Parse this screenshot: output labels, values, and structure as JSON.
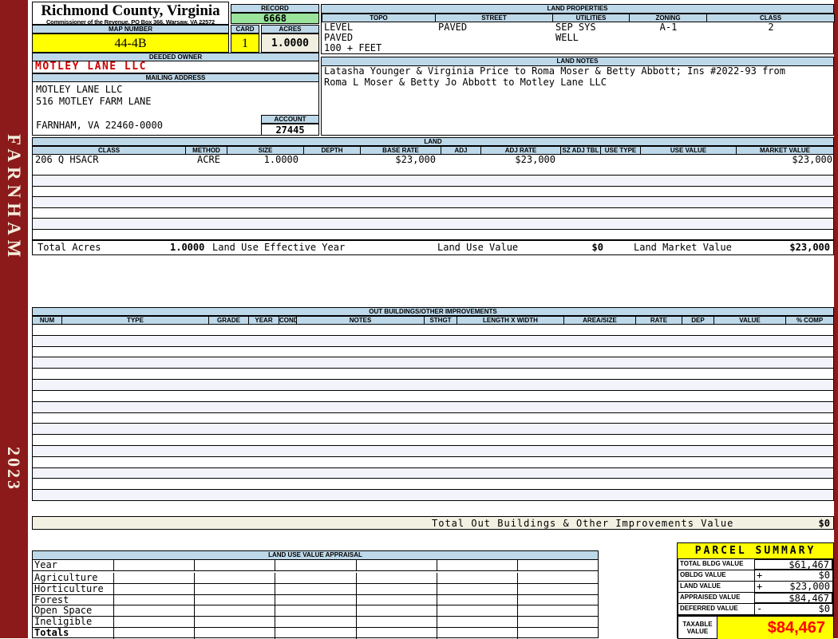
{
  "sidebar": {
    "district": "FARNHAM",
    "year": "2023"
  },
  "header": {
    "title": "Richmond County, Virginia",
    "subtitle": "Commissioner of the Revenue, PO Box 366, Warsaw, VA 22572",
    "record_label": "RECORD",
    "record_value": "6668",
    "map_number_label": "MAP NUMBER",
    "map_number_value": "44-4B",
    "card_label": "CARD",
    "card_value": "1",
    "acres_label": "ACRES",
    "acres_value": "1.0000",
    "deeded_owner_label": "DEEDED OWNER",
    "deeded_owner_value": "MOTLEY LANE LLC",
    "mailing_address_label": "MAILING ADDRESS",
    "mailing_address_lines": [
      "MOTLEY LANE LLC",
      "516 MOTLEY FARM LANE",
      "",
      "FARNHAM, VA 22460-0000"
    ],
    "account_label": "ACCOUNT",
    "account_value": "27445"
  },
  "land_properties": {
    "title": "LAND PROPERTIES",
    "columns": [
      "TOPO",
      "STREET",
      "UTILITIES",
      "ZONING",
      "CLASS"
    ],
    "value_rows": [
      [
        "LEVEL",
        "PAVED",
        "SEP SYS",
        "A-1",
        "2"
      ],
      [
        "PAVED",
        "",
        "WELL",
        "",
        ""
      ],
      [
        "100 + FEET",
        "",
        "",
        "",
        ""
      ]
    ]
  },
  "land_notes": {
    "title": "LAND NOTES",
    "lines": [
      "Latasha Younger & Virginia Price to Roma Moser & Betty Abbott; Ins #2022-93 from",
      "Roma L Moser & Betty Jo Abbott to Motley Lane LLC"
    ]
  },
  "land": {
    "title": "LAND",
    "columns": [
      "CLASS",
      "METHOD",
      "SIZE",
      "DEPTH",
      "BASE RATE",
      "ADJ",
      "ADJ RATE",
      "SZ ADJ TBL",
      "USE TYPE",
      "USE VALUE",
      "MARKET VALUE"
    ],
    "rows": [
      [
        "206 Q HSACR",
        "ACRE",
        "1.0000",
        "",
        "$23,000",
        "",
        "$23,000",
        "",
        "",
        "",
        "$23,000"
      ]
    ],
    "empty_row_count": 7,
    "totals": {
      "total_acres_label": "Total Acres",
      "total_acres_value": "1.0000",
      "effective_year_label": "Land Use Effective Year",
      "land_use_value_label": "Land Use Value",
      "land_use_value": "$0",
      "land_market_value_label": "Land Market Value",
      "land_market_value": "$23,000"
    }
  },
  "out_buildings": {
    "title": "OUT BUILDINGS/OTHER IMPROVEMENTS",
    "columns": [
      "NUM",
      "TYPE",
      "GRADE",
      "YEAR",
      "COND",
      "NOTES",
      "STHGT",
      "LENGTH X WIDTH",
      "AREA/SIZE",
      "RATE",
      "DEP",
      "VALUE",
      "% COMP"
    ],
    "empty_row_count": 16,
    "total_label": "Total Out Buildings & Other Improvements Value",
    "total_value": "$0"
  },
  "land_use_appraisal": {
    "title": "LAND USE VALUE APPRAISAL",
    "row_labels": [
      "Year",
      "Agriculture",
      "Horticulture",
      "Forest",
      "Open Space",
      "Ineligible",
      "Totals"
    ],
    "column_count": 6
  },
  "parcel_summary": {
    "title": "PARCEL SUMMARY",
    "rows": [
      {
        "label": "TOTAL BLDG VALUE",
        "op": "",
        "value": "$61,467"
      },
      {
        "label": "OBLDG VALUE",
        "op": "+",
        "value": "$0"
      },
      {
        "label": "LAND VALUE",
        "op": "+",
        "value": "$23,000"
      },
      {
        "label": "APPRAISED VALUE",
        "op": "",
        "value": "$84,467"
      },
      {
        "label": "DEFERRED VALUE",
        "op": "-",
        "value": "$0"
      }
    ],
    "taxable_label": "TAXABLE VALUE",
    "taxable_value": "$84,467"
  },
  "colors": {
    "maroon": "#8C1A1A",
    "header_blue": "#BDD8E9",
    "record_green": "#9BE49B",
    "highlight_yellow": "#FFFF00",
    "cream": "#F0EFE0",
    "owner_red": "#CC0000",
    "taxable_red": "#FF0000"
  }
}
